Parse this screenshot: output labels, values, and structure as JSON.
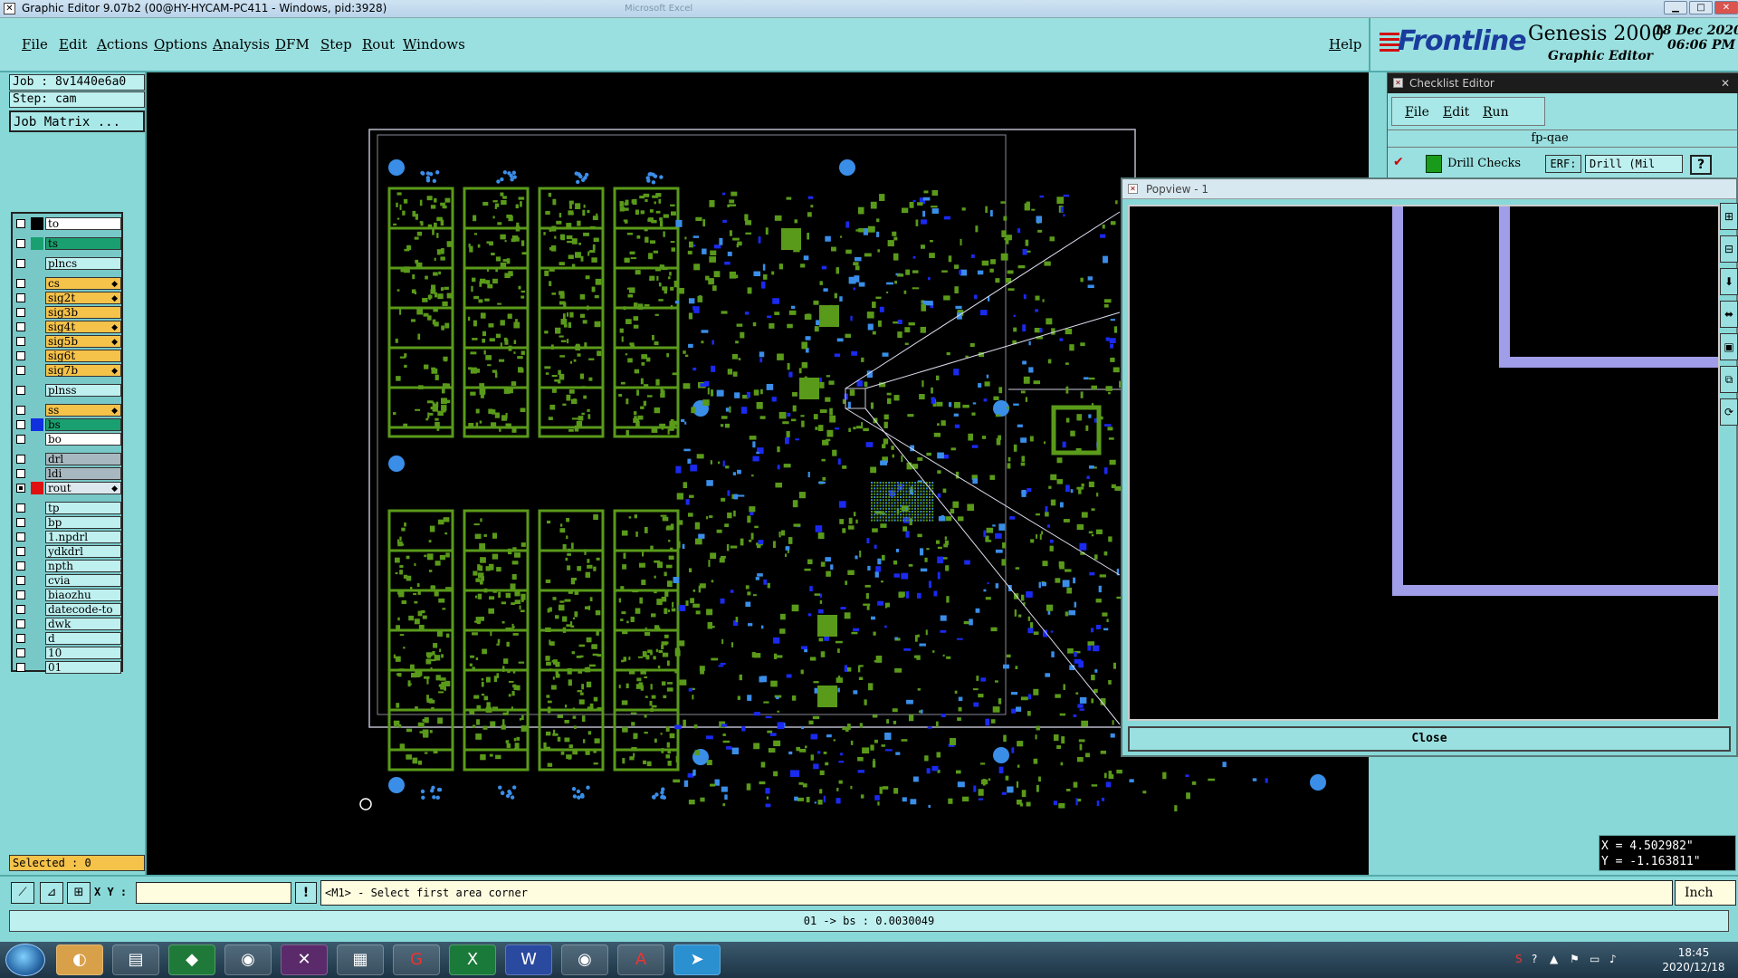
{
  "window": {
    "title": "Graphic Editor 9.07b2 (00@HY-HYCAM-PC411 - Windows, pid:3928)",
    "background_title": "Microsoft Excel"
  },
  "menu": {
    "items": [
      "File",
      "Edit",
      "Actions",
      "Options",
      "Analysis",
      "DFM",
      "Step",
      "Rout",
      "Windows"
    ],
    "help": "Help"
  },
  "logo": {
    "brand": "Frontline",
    "product": "Genesis 2000",
    "subtitle": "Graphic Editor",
    "date": "18 Dec 2020",
    "time": "06:06 PM"
  },
  "job": {
    "job_label": "Job : 8v1440e6a0",
    "step_label": "Step: cam",
    "matrix_button": "Job Matrix ..."
  },
  "layers": [
    {
      "name": "to",
      "color": "#ffffff",
      "swatch": "#000000",
      "checked": false
    },
    {
      "name": "ts",
      "color": "#1aa070",
      "swatch": "#1aa070",
      "checked": false
    },
    {
      "name": "plncs",
      "color": "#bff0f0",
      "swatch": null,
      "checked": false
    },
    {
      "name": "cs",
      "color": "#f5c24a",
      "swatch": null,
      "checked": false,
      "mark": true
    },
    {
      "name": "sig2t",
      "color": "#f5c24a",
      "swatch": null,
      "checked": false,
      "mark": true
    },
    {
      "name": "sig3b",
      "color": "#f5c24a",
      "swatch": null,
      "checked": false
    },
    {
      "name": "sig4t",
      "color": "#f5c24a",
      "swatch": null,
      "checked": false,
      "mark": true
    },
    {
      "name": "sig5b",
      "color": "#f5c24a",
      "swatch": null,
      "checked": false,
      "mark": true
    },
    {
      "name": "sig6t",
      "color": "#f5c24a",
      "swatch": null,
      "checked": false
    },
    {
      "name": "sig7b",
      "color": "#f5c24a",
      "swatch": null,
      "checked": false,
      "mark": true
    },
    {
      "name": "plnss",
      "color": "#bff0f0",
      "swatch": null,
      "checked": false
    },
    {
      "name": "ss",
      "color": "#f5c24a",
      "swatch": null,
      "checked": false,
      "mark": true
    },
    {
      "name": "bs",
      "color": "#1aa070",
      "swatch": "#1030e0",
      "checked": false
    },
    {
      "name": "bo",
      "color": "#ffffff",
      "swatch": null,
      "checked": false
    },
    {
      "name": "drl",
      "color": "#a8b8c0",
      "swatch": null,
      "checked": false
    },
    {
      "name": "ldi",
      "color": "#a8b8c0",
      "swatch": null,
      "checked": false
    },
    {
      "name": "rout",
      "color": "#dde8ee",
      "swatch": "#e01010",
      "checked": true,
      "mark": true
    },
    {
      "name": "tp",
      "color": "#bff0f0",
      "swatch": null,
      "checked": false
    },
    {
      "name": "bp",
      "color": "#bff0f0",
      "swatch": null,
      "checked": false
    },
    {
      "name": "1.npdrl",
      "color": "#bff0f0",
      "swatch": null,
      "checked": false
    },
    {
      "name": "ydkdrl",
      "color": "#bff0f0",
      "swatch": null,
      "checked": false
    },
    {
      "name": "npth",
      "color": "#bff0f0",
      "swatch": null,
      "checked": false
    },
    {
      "name": "cvia",
      "color": "#bff0f0",
      "swatch": null,
      "checked": false
    },
    {
      "name": "biaozhu",
      "color": "#bff0f0",
      "swatch": null,
      "checked": false
    },
    {
      "name": "datecode-to",
      "color": "#bff0f0",
      "swatch": null,
      "checked": false
    },
    {
      "name": "dwk",
      "color": "#bff0f0",
      "swatch": null,
      "checked": false
    },
    {
      "name": "d",
      "color": "#bff0f0",
      "swatch": null,
      "checked": false
    },
    {
      "name": "10",
      "color": "#bff0f0",
      "swatch": null,
      "checked": false
    },
    {
      "name": "01",
      "color": "#bff0f0",
      "swatch": null,
      "checked": false
    }
  ],
  "selected": "Selected : 0",
  "checklist": {
    "title": "Checklist Editor",
    "menu": [
      "File",
      "Edit",
      "Run"
    ],
    "name": "fp-qae",
    "row_label": "Drill Checks",
    "erf_label": "ERF:",
    "erf_value": "Drill (Mil",
    "help": "?"
  },
  "popview": {
    "title": "Popview - 1",
    "close": "Close"
  },
  "coords": {
    "x": "X = 4.502982\"",
    "y": "Y = -1.163811\""
  },
  "command": {
    "xy_label": "X Y :",
    "xy_value": "",
    "prompt": "<M1> - Select first area corner",
    "units": "Inch"
  },
  "status": "01 -> bs : 0.0030049",
  "taskbar": {
    "time": "18:45",
    "date": "2020/12/18"
  },
  "colors": {
    "pad_green": "#5a9a1a",
    "pad_blue": "#3a8ee8",
    "via_blue": "#1a2af0",
    "panel_teal": "#88d8d8",
    "popview_outline": "#a09ee8"
  }
}
